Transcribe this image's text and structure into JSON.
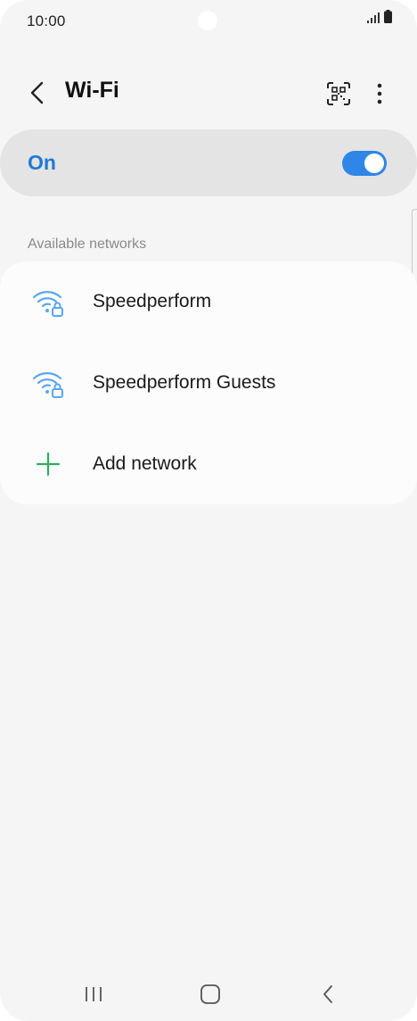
{
  "status_bar": {
    "time": "10:00",
    "icons": [
      "signal-icon",
      "battery-icon"
    ]
  },
  "header": {
    "title": "Wi-Fi",
    "icons": [
      "back-arrow-icon",
      "qr-code-icon",
      "more-vert-icon"
    ]
  },
  "master_switch": {
    "label": "On",
    "enabled": true
  },
  "section": {
    "title": "Available networks"
  },
  "networks": [
    {
      "name": "Speedperform",
      "icon": "wifi-lock-icon"
    },
    {
      "name": "Speedperform Guests",
      "icon": "wifi-lock-icon"
    }
  ],
  "add_network": {
    "label": "Add network",
    "icon": "plus-icon"
  },
  "nav_bar": {
    "icons": [
      "recents-icon",
      "home-icon",
      "back-icon"
    ]
  },
  "colors": {
    "accent": "#2f86e6",
    "accent_text": "#1f7ad6",
    "wifi_icon": "#5aa6ee",
    "add_icon": "#2eae5b",
    "background": "#f5f5f5",
    "card": "#fcfcfc"
  }
}
